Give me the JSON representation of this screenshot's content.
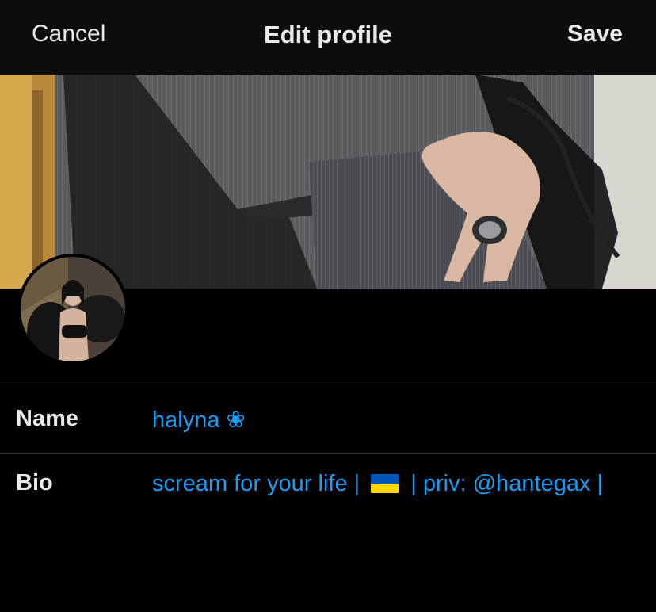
{
  "navbar": {
    "cancel_label": "Cancel",
    "title": "Edit profile",
    "save_label": "Save"
  },
  "colors": {
    "background": "#000000",
    "navbar": "#0d0d0d",
    "text": "#e7e9ea",
    "accent": "#1d9bf0",
    "divider": "#2f3336"
  },
  "fields": {
    "name": {
      "label": "Name",
      "value": "halyna ❀"
    },
    "bio": {
      "label": "Bio",
      "value_before_flag": "scream for your life | ",
      "flag_icon": "ukraine-flag-icon",
      "value_after_flag": " | priv: @hantegax |"
    }
  }
}
